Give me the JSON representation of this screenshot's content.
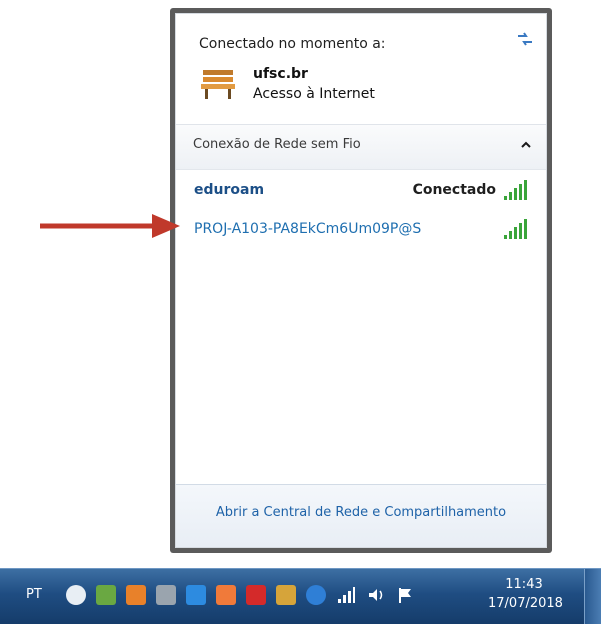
{
  "flyout": {
    "current_header": "Conectado no momento a:",
    "current_network": {
      "name": "ufsc.br",
      "access": "Acesso à Internet"
    },
    "section_label": "Conexão de Rede sem Fio",
    "networks": [
      {
        "ssid": "eduroam",
        "status": "Conectado"
      },
      {
        "ssid": "PROJ-A103-PA8EkCm6Um09P@S",
        "status": ""
      }
    ],
    "footer_link": "Abrir a Central de Rede e Compartilhamento"
  },
  "taskbar": {
    "language": "PT",
    "time": "11:43",
    "date": "17/07/2018",
    "tray_icons": [
      "cloud-icon",
      "network-sync-icon",
      "orange-app-icon",
      "camera-icon",
      "onedrive-icon",
      "bird-icon",
      "red-app-icon",
      "people-icon",
      "teamviewer-icon",
      "signal-icon",
      "volume-icon",
      "flag-icon"
    ]
  },
  "colors": {
    "accent_link": "#1e62a8",
    "arrow": "#c0392b",
    "taskbar": "#1f4d82"
  }
}
